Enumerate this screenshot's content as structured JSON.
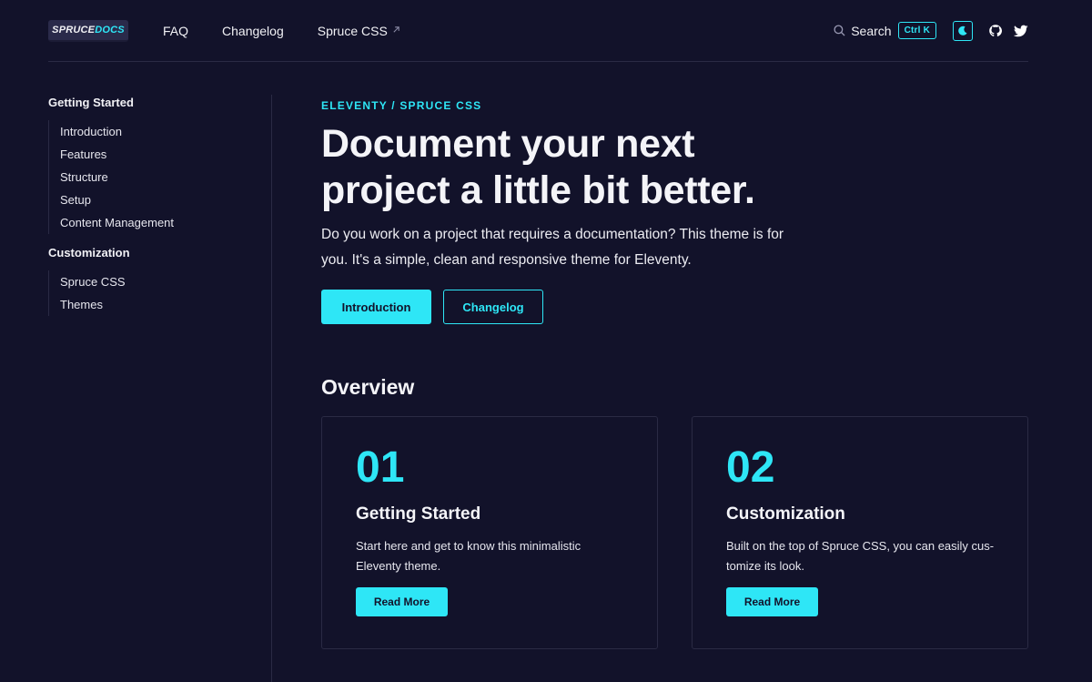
{
  "header": {
    "logo_part1": "SPRUCE",
    "logo_part2": "DOCS",
    "nav": [
      {
        "label": "FAQ"
      },
      {
        "label": "Changelog"
      },
      {
        "label": "Spruce CSS",
        "external": true
      }
    ],
    "search_label": "Search",
    "search_shortcut": "Ctrl K",
    "icons": [
      "search-icon",
      "moon-icon",
      "github-icon",
      "twitter-icon"
    ]
  },
  "sidebar": {
    "sections": [
      {
        "heading": "Getting Started",
        "items": [
          "Introduction",
          "Features",
          "Structure",
          "Setup",
          "Content Management"
        ]
      },
      {
        "heading": "Customization",
        "items": [
          "Spruce CSS",
          "Themes"
        ]
      }
    ]
  },
  "hero": {
    "eyebrow": "ELEVENTY / SPRUCE CSS",
    "title": "Document your next project a little bit better.",
    "text": "Do you work on a project that requires a documentation? This theme is for you. It's a simple, clean and responsive theme for Eleventy.",
    "primary_button": "Introduction",
    "secondary_button": "Changelog"
  },
  "overview": {
    "title": "Overview",
    "cards": [
      {
        "number": "01",
        "title": "Getting Started",
        "text": "Start here and get to know this minimalistic Eleventy theme.",
        "button": "Read More"
      },
      {
        "number": "02",
        "title": "Customization",
        "text": "Built on the top of Spruce CSS, you can easily cus-tomize its look.",
        "button": "Read More"
      }
    ]
  },
  "colors": {
    "background": "#12122a",
    "accent": "#2ee6f6",
    "border": "#2a2a44",
    "text": "#f1f1f5"
  }
}
